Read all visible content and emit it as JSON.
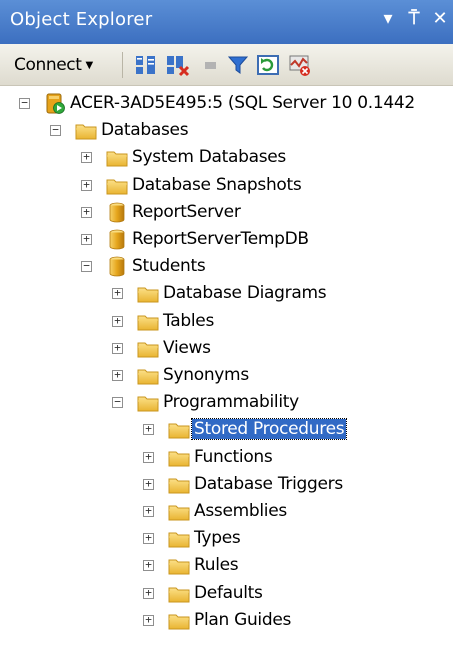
{
  "window": {
    "title": "Object Explorer",
    "pin_glyph": "⍑",
    "close_glyph": "✕",
    "dropdown_glyph": "▾"
  },
  "toolbar": {
    "connect_label": "Connect",
    "icons": [
      "connect-object-explorer-icon",
      "disconnect-icon",
      "stop-icon",
      "filter-icon",
      "refresh-icon",
      "activity-monitor-icon"
    ]
  },
  "tree": [
    {
      "label": "ACER-3AD5E495:5 (SQL Server 10 0.1442",
      "icon": "server",
      "depth": 0,
      "state": "collapse"
    },
    {
      "label": "Databases",
      "icon": "folder",
      "depth": 1,
      "state": "collapse"
    },
    {
      "label": "System Databases",
      "icon": "folder",
      "depth": 2,
      "state": "expand"
    },
    {
      "label": "Database Snapshots",
      "icon": "folder",
      "depth": 2,
      "state": "expand"
    },
    {
      "label": "ReportServer",
      "icon": "database",
      "depth": 2,
      "state": "expand"
    },
    {
      "label": "ReportServerTempDB",
      "icon": "database",
      "depth": 2,
      "state": "expand"
    },
    {
      "label": "Students",
      "icon": "database",
      "depth": 2,
      "state": "collapse"
    },
    {
      "label": "Database Diagrams",
      "icon": "folder",
      "depth": 3,
      "state": "expand"
    },
    {
      "label": "Tables",
      "icon": "folder",
      "depth": 3,
      "state": "expand"
    },
    {
      "label": "Views",
      "icon": "folder",
      "depth": 3,
      "state": "expand"
    },
    {
      "label": "Synonyms",
      "icon": "folder",
      "depth": 3,
      "state": "expand"
    },
    {
      "label": "Programmability",
      "icon": "folder",
      "depth": 3,
      "state": "collapse"
    },
    {
      "label": "Stored Procedures",
      "icon": "folder",
      "depth": 4,
      "state": "expand",
      "selected": true
    },
    {
      "label": "Functions",
      "icon": "folder",
      "depth": 4,
      "state": "expand"
    },
    {
      "label": "Database Triggers",
      "icon": "folder",
      "depth": 4,
      "state": "expand"
    },
    {
      "label": "Assemblies",
      "icon": "folder",
      "depth": 4,
      "state": "expand"
    },
    {
      "label": "Types",
      "icon": "folder",
      "depth": 4,
      "state": "expand"
    },
    {
      "label": "Rules",
      "icon": "folder",
      "depth": 4,
      "state": "expand"
    },
    {
      "label": "Defaults",
      "icon": "folder",
      "depth": 4,
      "state": "expand"
    },
    {
      "label": "Plan Guides",
      "icon": "folder",
      "depth": 4,
      "state": "expand"
    }
  ],
  "colors": {
    "title_bar": "#3c6fc0",
    "selection": "#316ac5",
    "folder": "#f3c445",
    "database": "#e5a51c"
  }
}
